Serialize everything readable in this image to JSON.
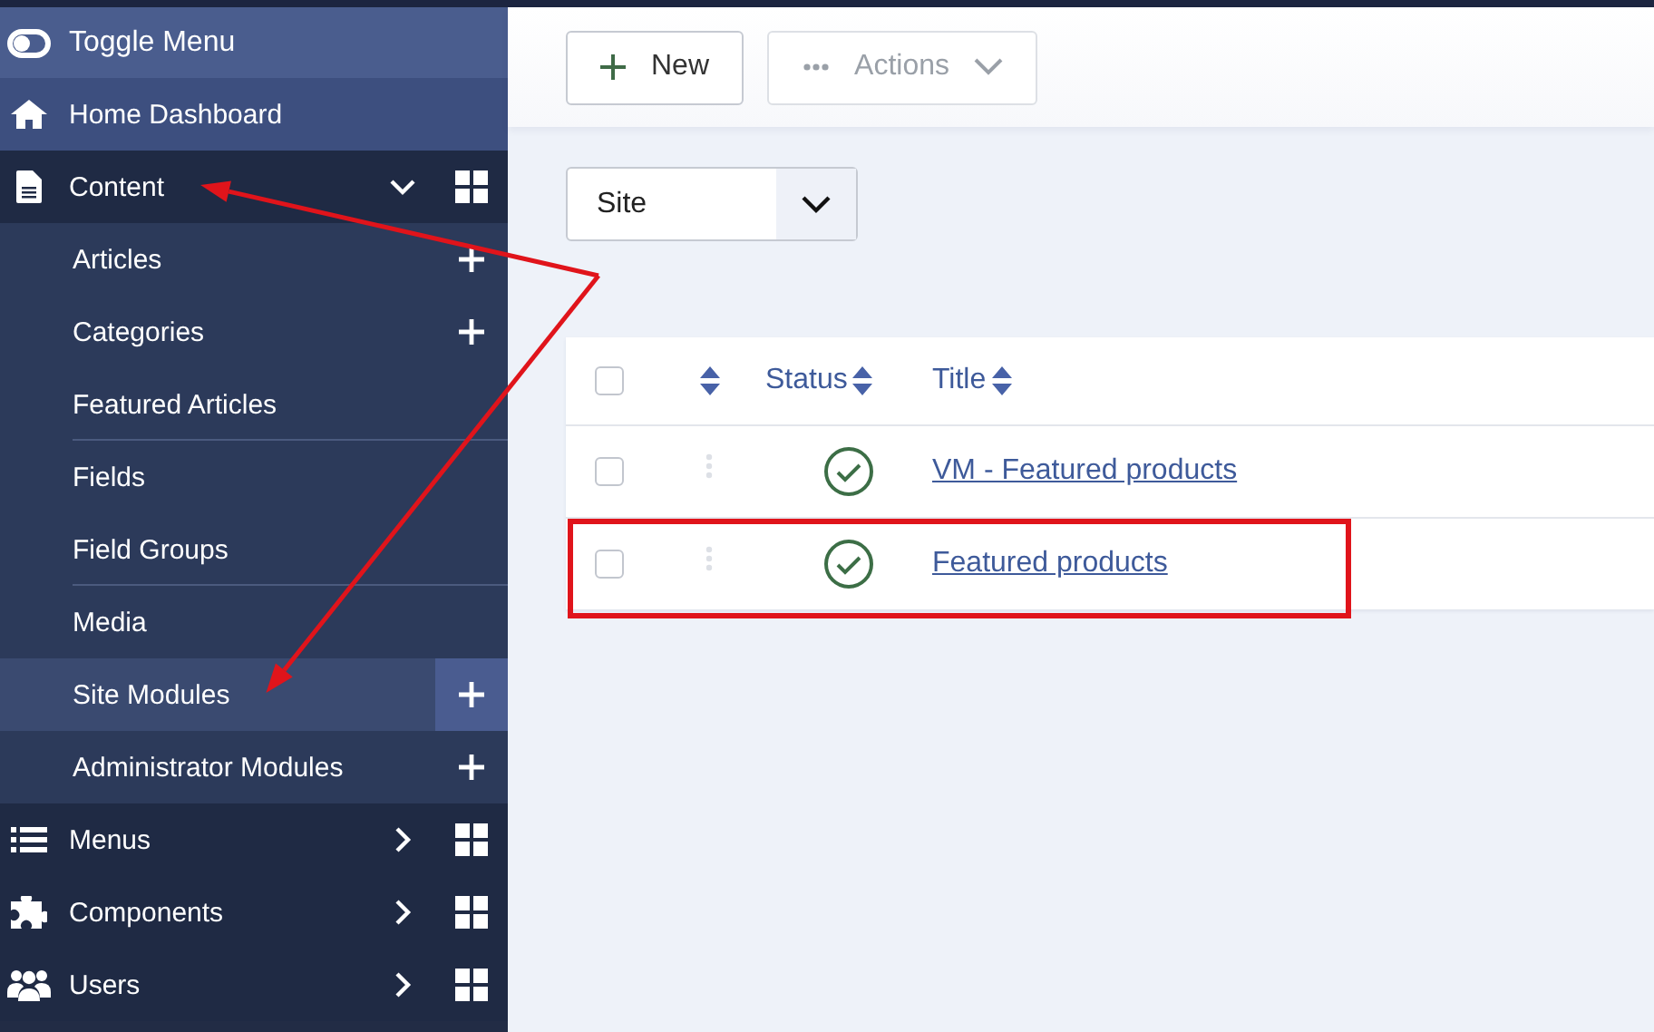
{
  "sidebar": {
    "toggle": {
      "label": "Toggle Menu"
    },
    "items": [
      {
        "label": "Home Dashboard",
        "kind": "link"
      },
      {
        "label": "Content",
        "kind": "section",
        "expanded": true,
        "arrow_target": true,
        "children": [
          {
            "label": "Articles",
            "add": true,
            "selected": false,
            "group_end": false
          },
          {
            "label": "Categories",
            "add": true,
            "selected": false,
            "group_end": false
          },
          {
            "label": "Featured Articles",
            "add": false,
            "selected": false,
            "group_end": true
          },
          {
            "label": "Fields",
            "add": false,
            "selected": false,
            "group_end": false
          },
          {
            "label": "Field Groups",
            "add": false,
            "selected": false,
            "group_end": true
          },
          {
            "label": "Media",
            "add": false,
            "selected": false,
            "group_end": false
          },
          {
            "label": "Site Modules",
            "add": true,
            "selected": true,
            "group_end": false,
            "arrow_target": true
          },
          {
            "label": "Administrator Modules",
            "add": true,
            "selected": false,
            "group_end": false
          }
        ]
      },
      {
        "label": "Menus",
        "kind": "section",
        "expanded": false
      },
      {
        "label": "Components",
        "kind": "section",
        "expanded": false
      },
      {
        "label": "Users",
        "kind": "section",
        "expanded": false
      }
    ]
  },
  "toolbar": {
    "buttons": [
      {
        "label": "New",
        "kind": "new",
        "disabled": false
      },
      {
        "label": "Actions",
        "kind": "actions",
        "disabled": true
      }
    ]
  },
  "filter": {
    "value": "Site"
  },
  "table": {
    "select_all_checked": false,
    "columns": [
      {
        "kind": "checkbox"
      },
      {
        "kind": "ordering"
      },
      {
        "kind": "text",
        "label": "Status"
      },
      {
        "kind": "text",
        "label": "Title"
      }
    ],
    "rows": [
      {
        "checked": false,
        "published": true,
        "title": "VM - Featured products",
        "highlighted": false
      },
      {
        "checked": false,
        "published": true,
        "title": "Featured products",
        "highlighted": true
      }
    ]
  }
}
